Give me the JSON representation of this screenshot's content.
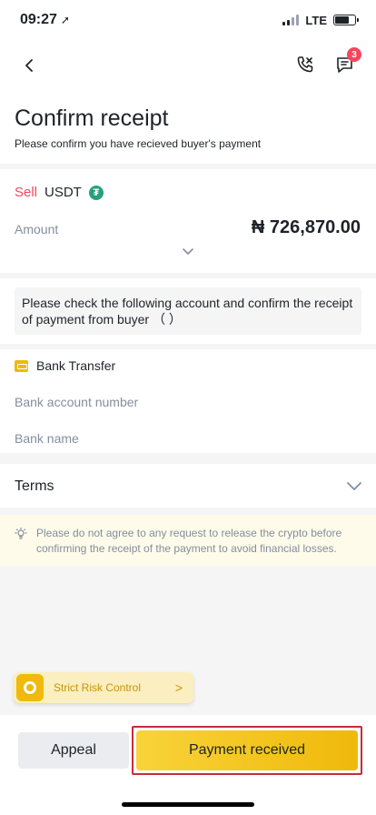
{
  "status_bar": {
    "time": "09:27",
    "location_glyph": "➚",
    "network": "LTE"
  },
  "nav": {
    "back_icon": "chevron-left-icon",
    "call_icon": "phone-icon",
    "chat_icon": "chat-icon",
    "chat_badge": "3"
  },
  "header": {
    "title": "Confirm receipt",
    "subtitle": "Please confirm you have recieved buyer's payment"
  },
  "order": {
    "side": "Sell",
    "asset": "USDT",
    "asset_icon_glyph": "₮",
    "amount_label": "Amount",
    "amount_value": "₦ 726,870.00"
  },
  "notice": {
    "text": "Please check the following account and confirm the receipt of payment from buyer （ ）"
  },
  "bank": {
    "method": "Bank Transfer",
    "account_number_label": "Bank account number",
    "bank_name_label": "Bank name"
  },
  "terms": {
    "label": "Terms"
  },
  "warning": {
    "text": "Please do not agree to any request to release the crypto before confirming the receipt of the payment to avoid financial losses."
  },
  "risk": {
    "label": "Strict Risk Control",
    "arrow": ">"
  },
  "actions": {
    "appeal": "Appeal",
    "confirm": "Payment received"
  },
  "colors": {
    "sell": "#f6465d",
    "brand": "#f0b90b",
    "badge": "#f6465d",
    "tether": "#26a17b",
    "highlight_outline": "#c92a3e"
  }
}
